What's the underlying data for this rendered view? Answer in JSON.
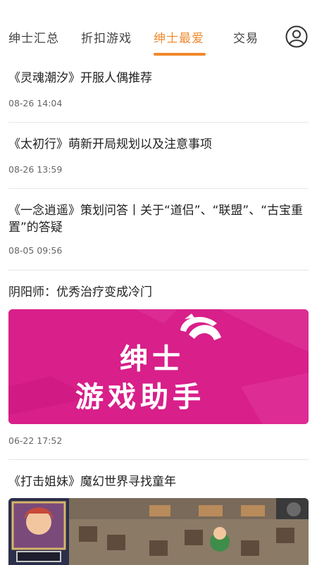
{
  "tabs": [
    {
      "label": "绅士汇总"
    },
    {
      "label": "折扣游戏"
    },
    {
      "label": "绅士最爱"
    },
    {
      "label": "交易"
    }
  ],
  "active_tab_index": 2,
  "articles": [
    {
      "title": "《灵魂潮汐》开服人偶推荐",
      "date": "08-26 14:04"
    },
    {
      "title": "《太初行》萌新开局规划以及注意事项",
      "date": "08-26 13:59"
    },
    {
      "title_line1": "《一念逍遥》策划问答丨关于“道侣”、“联盟”、“古宝重",
      "title_line2": "置”的答疑",
      "date": "08-05 09:56"
    },
    {
      "title": "阴阳师：优秀治疗变成冷门",
      "date": "06-22 17:52",
      "banner_line1": "绅士",
      "banner_line2": "游戏助手"
    },
    {
      "title": "《打击姐妹》魔幻世界寻找童年"
    }
  ],
  "colors": {
    "accent": "#f08a2d",
    "banner": "#d81f8a"
  },
  "icons": {
    "profile": "user-circle-icon"
  }
}
